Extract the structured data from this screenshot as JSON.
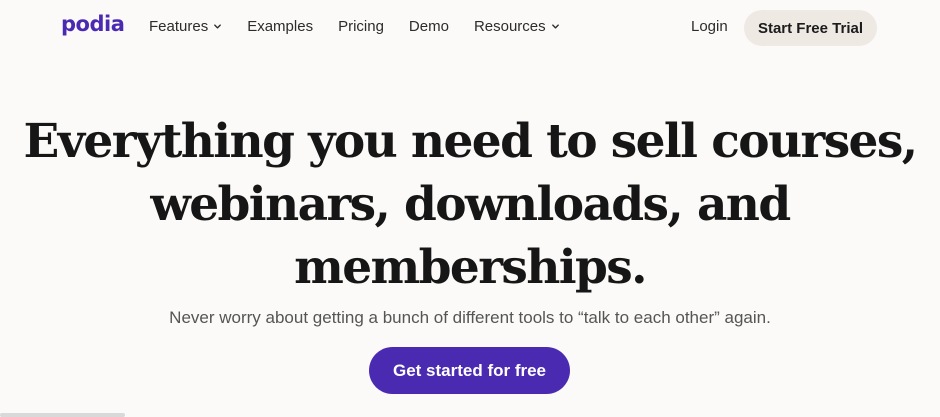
{
  "brand": {
    "logo_text": "podia",
    "accent_color": "#4b2ab2"
  },
  "nav": {
    "links": [
      {
        "label": "Features",
        "has_dropdown": true
      },
      {
        "label": "Examples",
        "has_dropdown": false
      },
      {
        "label": "Pricing",
        "has_dropdown": false
      },
      {
        "label": "Demo",
        "has_dropdown": false
      },
      {
        "label": "Resources",
        "has_dropdown": true
      }
    ],
    "login_label": "Login",
    "trial_button_label": "Start Free Trial"
  },
  "hero": {
    "headline_lines": [
      "Everything you need to sell courses,",
      "webinars, downloads, and",
      "memberships."
    ],
    "subheadline": "Never worry about getting a bunch of different tools to “talk to each other” again.",
    "cta_label": "Get started for free"
  },
  "icons": {
    "dropdown": "chevron-down-icon"
  }
}
